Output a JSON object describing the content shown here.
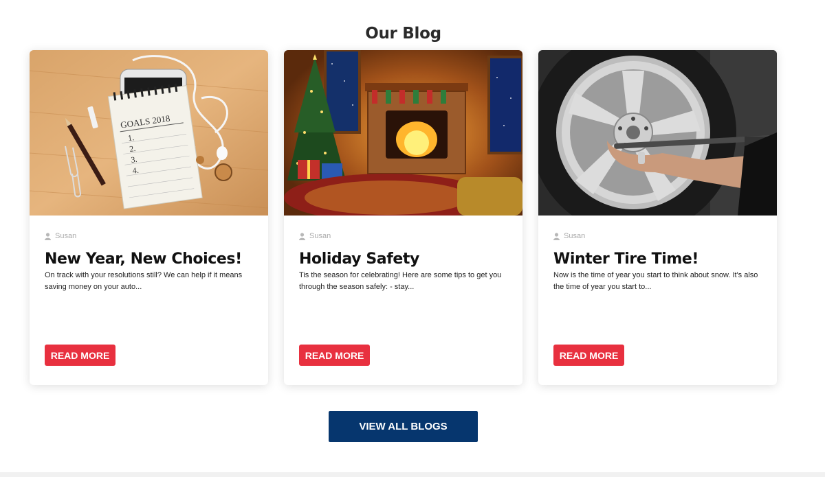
{
  "section": {
    "title": "Our Blog"
  },
  "posts": [
    {
      "image_alt": "Goals 2018 notepad with phone and pencil",
      "author": "Susan",
      "title": "New Year, New Choices!",
      "excerpt": "On track with your resolutions still?  We can help if it means saving money on your auto...",
      "read_more": "READ MORE",
      "image_text": "GOALS 2018",
      "list_items": [
        "1.",
        "2.",
        "3.",
        "4."
      ]
    },
    {
      "image_alt": "Cozy living room with Christmas tree and fireplace",
      "author": "Susan",
      "title": "Holiday Safety",
      "excerpt": "Tis the season for celebrating! Here are some tips to get you through the season safely: - stay...",
      "read_more": "READ MORE"
    },
    {
      "image_alt": "Mechanic tightening lug nuts on a winter tire",
      "author": "Susan",
      "title": "Winter Tire Time!",
      "excerpt": "Now is the time of year you start to think about snow. It's also the time of year you start to...",
      "read_more": "READ MORE"
    }
  ],
  "view_all": {
    "label": "VIEW ALL BLOGS"
  },
  "colors": {
    "read_more_bg": "#e8303f",
    "view_all_bg": "#06366e",
    "author_text": "#a9a9a9"
  },
  "icons": {
    "author": "user-icon"
  }
}
